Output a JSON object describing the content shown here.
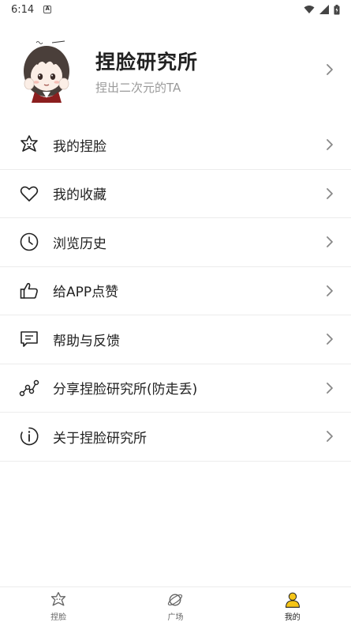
{
  "status_bar": {
    "time": "6:14",
    "notif_letter": "A"
  },
  "profile": {
    "name": "捏脸研究所",
    "description": "捏出二次元的TA"
  },
  "menu": [
    {
      "label": "我的捏脸",
      "icon": "face-star-icon"
    },
    {
      "label": "我的收藏",
      "icon": "heart-icon"
    },
    {
      "label": "浏览历史",
      "icon": "clock-icon"
    },
    {
      "label": "给APP点赞",
      "icon": "thumbs-up-icon"
    },
    {
      "label": "帮助与反馈",
      "icon": "message-icon"
    },
    {
      "label": "分享捏脸研究所(防走丢)",
      "icon": "share-icon"
    },
    {
      "label": "关于捏脸研究所",
      "icon": "info-icon"
    }
  ],
  "tabs": [
    {
      "label": "捏脸",
      "icon": "face-star-icon",
      "active": false
    },
    {
      "label": "广场",
      "icon": "planet-icon",
      "active": false
    },
    {
      "label": "我的",
      "icon": "person-icon",
      "active": true
    }
  ],
  "colors": {
    "accent": "#f5c518",
    "text": "#222222",
    "muted": "#9a9a9a",
    "divider": "#ececec"
  }
}
